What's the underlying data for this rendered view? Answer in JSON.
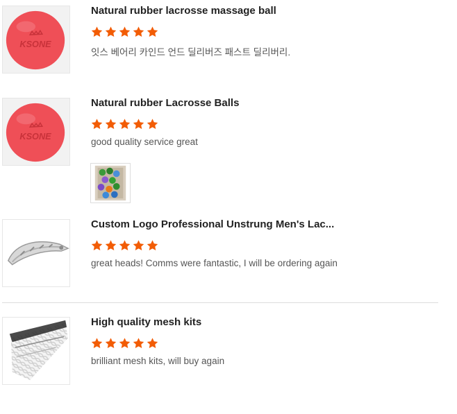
{
  "reviews": [
    {
      "title": "Natural rubber lacrosse massage ball",
      "rating": 5,
      "comment": "잇스 베어리 카인드 언드 딜리버즈 패스트 딜리버리.",
      "thumb_icon": "red-lacrosse-ball-image",
      "thumb_text": "KSONE"
    },
    {
      "title": "Natural rubber Lacrosse Balls",
      "rating": 5,
      "comment": "good quality service great",
      "thumb_icon": "red-lacrosse-ball-image",
      "thumb_text": "KSONE",
      "attachment_icon": "box-of-colored-balls-photo"
    },
    {
      "title": "Custom Logo Professional Unstrung Men's Lac...",
      "rating": 5,
      "comment": "great heads! Comms were fantastic, I will be ordering again",
      "thumb_icon": "lacrosse-head-image"
    },
    {
      "title": "High quality mesh kits",
      "rating": 5,
      "comment": "brilliant mesh kits, will buy again",
      "thumb_icon": "mesh-kit-image"
    }
  ],
  "colors": {
    "star": "#f25c05",
    "ball": "#ef4f57",
    "title": "#222222",
    "comment": "#555555"
  }
}
